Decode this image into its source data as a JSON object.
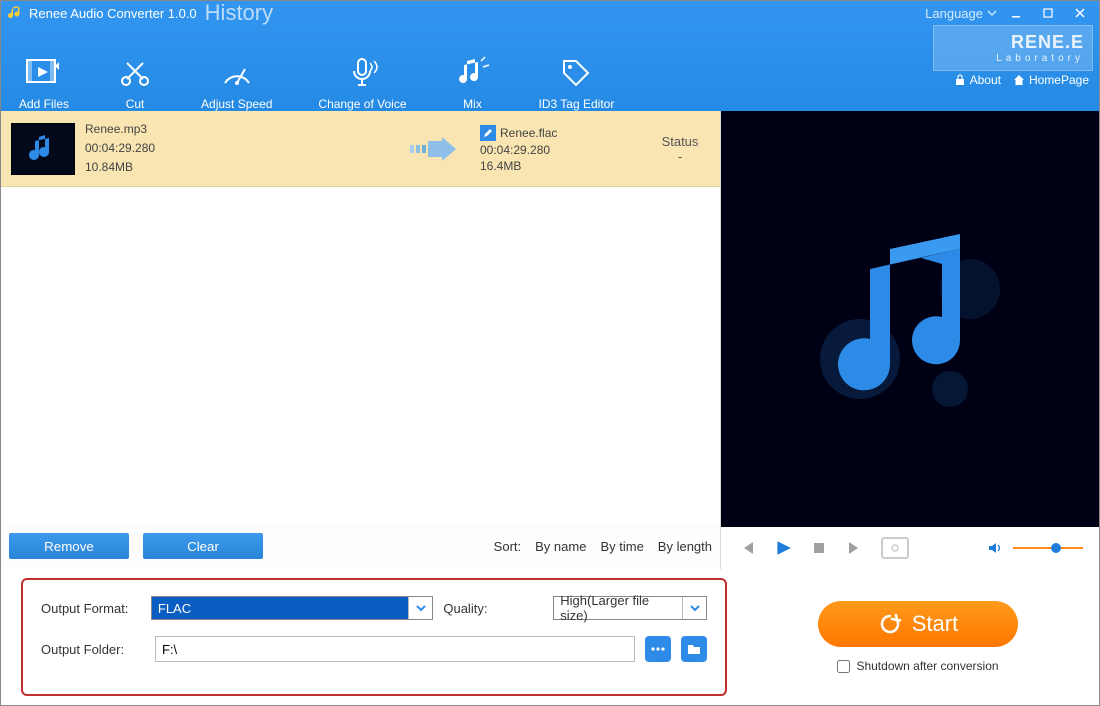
{
  "app": {
    "title": "Renee Audio Converter 1.0.0",
    "history": "History",
    "language_label": "Language",
    "about": "About",
    "homepage": "HomePage",
    "brand_top": "RENE.E",
    "brand_sub": "Laboratory"
  },
  "toolbar": {
    "add_files": "Add Files",
    "cut": "Cut",
    "adjust_speed": "Adjust Speed",
    "change_voice": "Change of Voice",
    "mix": "Mix",
    "id3": "ID3 Tag Editor"
  },
  "item": {
    "src_name": "Renee.mp3",
    "src_duration": "00:04:29.280",
    "src_size": "10.84MB",
    "dst_name": "Renee.flac",
    "dst_duration": "00:04:29.280",
    "dst_size": "16.4MB",
    "status_header": "Status",
    "status_value": "-"
  },
  "list_controls": {
    "remove": "Remove",
    "clear": "Clear",
    "sort_label": "Sort:",
    "by_name": "By name",
    "by_time": "By time",
    "by_length": "By length"
  },
  "output": {
    "format_label": "Output Format:",
    "format_value": "FLAC",
    "quality_label": "Quality:",
    "quality_value": "High(Larger file size)",
    "folder_label": "Output Folder:",
    "folder_value": "F:\\"
  },
  "action": {
    "start": "Start",
    "shutdown": "Shutdown after conversion"
  }
}
